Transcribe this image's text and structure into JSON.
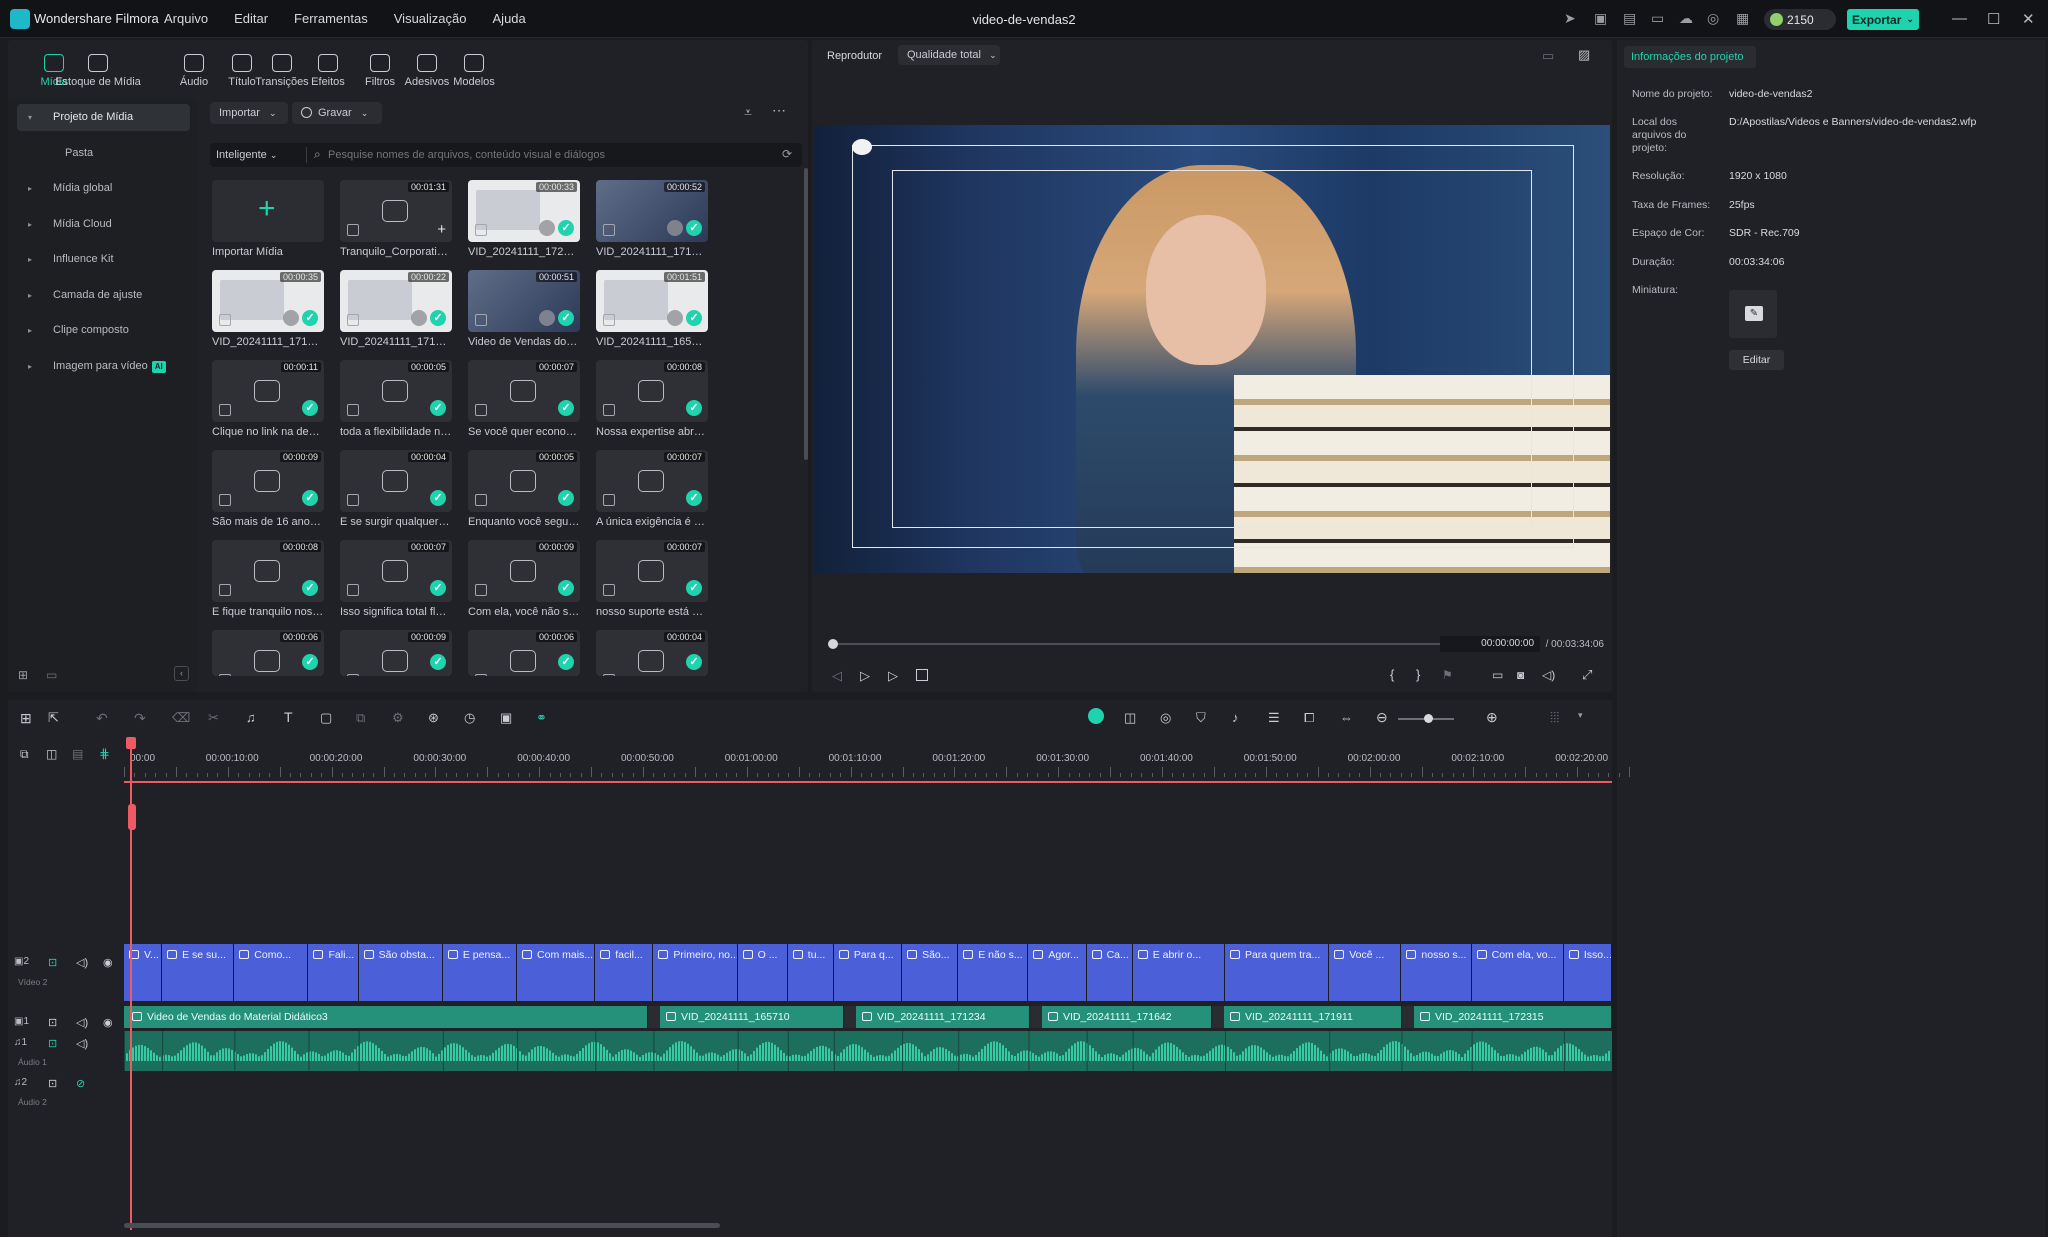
{
  "app": {
    "name": "Wondershare Filmora",
    "document_title": "video-de-vendas2"
  },
  "menu": [
    "Arquivo",
    "Editar",
    "Ferramentas",
    "Visualização",
    "Ajuda"
  ],
  "topbar": {
    "credits": "2150",
    "export_label": "Exportar"
  },
  "media_tabs": [
    {
      "label": "Mídia",
      "active": true,
      "icon": "media-icon"
    },
    {
      "label": "Estoque de Mídia",
      "active": false,
      "icon": "stock-media-icon"
    },
    {
      "label": "Áudio",
      "active": false,
      "icon": "music-note-icon"
    },
    {
      "label": "Título",
      "active": false,
      "icon": "title-text-icon"
    },
    {
      "label": "Transições",
      "active": false,
      "icon": "transition-icon"
    },
    {
      "label": "Efeitos",
      "active": false,
      "icon": "effects-icon"
    },
    {
      "label": "Filtros",
      "active": false,
      "icon": "filter-icon"
    },
    {
      "label": "Adesivos",
      "active": false,
      "icon": "sticker-icon"
    },
    {
      "label": "Modelos",
      "active": false,
      "icon": "template-icon"
    }
  ],
  "sidebar": [
    {
      "label": "Projeto de Mídia",
      "active": true
    },
    {
      "label": "Pasta",
      "active": false
    },
    {
      "label": "Mídia global",
      "active": false
    },
    {
      "label": "Mídia Cloud",
      "active": false
    },
    {
      "label": "Influence Kit",
      "active": false
    },
    {
      "label": "Camada de ajuste",
      "active": false
    },
    {
      "label": "Clipe composto",
      "active": false
    },
    {
      "label": "Imagem para vídeo",
      "active": false,
      "badge": "AI"
    }
  ],
  "media_toolbar": {
    "import_label": "Importar",
    "record_label": "Gravar",
    "sort_label": "Inteligente",
    "search_placeholder": "Pesquise nomes de arquivos, conteúdo visual e diálogos"
  },
  "media_items": [
    {
      "name": "Importar Mídia",
      "duration": "",
      "kind": "import"
    },
    {
      "name": "Tranquilo_Corporativo...",
      "duration": "00:01:31",
      "kind": "audio",
      "used": false
    },
    {
      "name": "VID_20241111_172315",
      "duration": "00:00:33",
      "kind": "video",
      "used": true
    },
    {
      "name": "VID_20241111_171911",
      "duration": "00:00:52",
      "kind": "photo",
      "used": true
    },
    {
      "name": "VID_20241111_171642",
      "duration": "00:00:35",
      "kind": "video",
      "used": true
    },
    {
      "name": "VID_20241111_171234",
      "duration": "00:00:22",
      "kind": "video",
      "used": true
    },
    {
      "name": "Video de Vendas do M...",
      "duration": "00:00:51",
      "kind": "photo",
      "used": true
    },
    {
      "name": "VID_20241111_165710",
      "duration": "00:01:51",
      "kind": "video",
      "used": true
    },
    {
      "name": "Clique no link na desc...",
      "duration": "00:00:11",
      "kind": "audio",
      "used": true
    },
    {
      "name": "toda a flexibilidade ne...",
      "duration": "00:00:05",
      "kind": "audio",
      "used": true
    },
    {
      "name": "Se você quer economi...",
      "duration": "00:00:07",
      "kind": "audio",
      "used": true
    },
    {
      "name": "Nossa expertise abran...",
      "duration": "00:00:08",
      "kind": "audio",
      "used": true
    },
    {
      "name": "São mais de 16 anos d...",
      "duration": "00:00:09",
      "kind": "audio",
      "used": true
    },
    {
      "name": "E se surgir qualquer d...",
      "duration": "00:00:04",
      "kind": "audio",
      "used": true
    },
    {
      "name": "Enquanto você seguir ...",
      "duration": "00:00:05",
      "kind": "audio",
      "used": true
    },
    {
      "name": "A única exigência é m...",
      "duration": "00:00:07",
      "kind": "audio",
      "used": true
    },
    {
      "name": "E fique tranquilo noss...",
      "duration": "00:00:08",
      "kind": "audio",
      "used": true
    },
    {
      "name": "Isso significa total flex_1",
      "duration": "00:00:07",
      "kind": "audio",
      "used": true
    },
    {
      "name": "Com ela, você não só ...",
      "duration": "00:00:09",
      "kind": "audio",
      "used": true
    },
    {
      "name": "nosso suporte está dis...",
      "duration": "00:00:07",
      "kind": "audio",
      "used": true
    },
    {
      "name": "",
      "duration": "00:00:06",
      "kind": "audio",
      "used": true
    },
    {
      "name": "",
      "duration": "00:00:09",
      "kind": "audio",
      "used": true
    },
    {
      "name": "",
      "duration": "00:00:06",
      "kind": "audio",
      "used": true
    },
    {
      "name": "",
      "duration": "00:00:04",
      "kind": "audio",
      "used": true
    }
  ],
  "player": {
    "label": "Reprodutor",
    "quality": "Qualidade total",
    "current_time": "00:00:00:00",
    "total_time": "/ 00:03:34:06",
    "progress": 0
  },
  "project_info": {
    "tab": "Informações do projeto",
    "rows": [
      {
        "label": "Nome do projeto:",
        "value": "video-de-vendas2"
      },
      {
        "label": "Local dos arquivos do projeto:",
        "value": "D:/Apostilas/Videos e Banners/video-de-vendas2.wfp"
      },
      {
        "label": "Resolução:",
        "value": "1920 x 1080"
      },
      {
        "label": "Taxa de Frames:",
        "value": "25fps"
      },
      {
        "label": "Espaço de Cor:",
        "value": "SDR - Rec.709"
      },
      {
        "label": "Duração:",
        "value": "00:03:34:06"
      },
      {
        "label": "Miniatura:",
        "value": ""
      }
    ],
    "edit_label": "Editar"
  },
  "timeline": {
    "ruler": [
      "00:00",
      "00:00:10:00",
      "00:00:20:00",
      "00:00:30:00",
      "00:00:40:00",
      "00:00:50:00",
      "00:01:00:00",
      "00:01:10:00",
      "00:01:20:00",
      "00:01:30:00",
      "00:01:40:00",
      "00:01:50:00",
      "00:02:00:00",
      "00:02:10:00",
      "00:02:20:00"
    ],
    "tracks": {
      "video2": {
        "num": "2",
        "name": "Vídeo 2"
      },
      "video1": {
        "num": "1",
        "name": ""
      },
      "audio1": {
        "num": "1",
        "name": "Áudio 1"
      },
      "audio2": {
        "num": "2",
        "name": "Áudio 2"
      }
    },
    "title_clips": [
      "V...",
      "E se su...",
      "Como...",
      "Fali...",
      "São obsta...",
      "E pensa...",
      "Com mais...",
      "facil...",
      "Primeiro, no...",
      "O ...",
      "tu...",
      "Para q...",
      "São...",
      "E não s...",
      "Agor...",
      "Ca...",
      "E abrir o...",
      "Para quem tra...",
      "Você ...",
      "nosso s...",
      "Com ela, vo...",
      "Isso..."
    ],
    "video_clips": [
      "Video de Vendas do Material Didático3",
      "VID_20241111_165710",
      "VID_20241111_171234",
      "VID_20241111_171642",
      "VID_20241111_171911",
      "VID_20241111_172315"
    ]
  },
  "colors": {
    "accent": "#1ed3ad",
    "title_clip": "#4b5fd8",
    "video_clip": "#25917b",
    "playhead": "#ee5a64"
  }
}
